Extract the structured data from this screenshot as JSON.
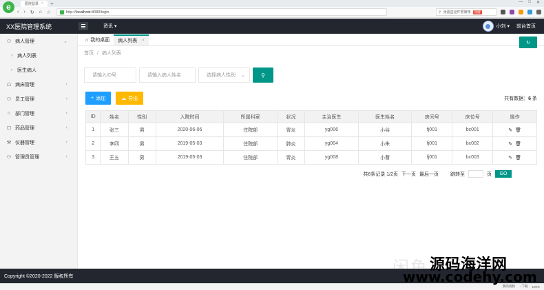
{
  "browser": {
    "tab_title": "医院登录",
    "url_scheme": "http://",
    "url_host": "localhost",
    "url_path": ":8080/login",
    "search_placeholder": "张嘉益证件照被用",
    "hot_badge": "热搜",
    "new_tab": "+",
    "win_controls": [
      "—",
      "□",
      "✕"
    ]
  },
  "header": {
    "app_name": "XX医院管理系统",
    "news": "资讯 ▾",
    "user": "小刘 ▾",
    "front_page": "前台首页"
  },
  "sidebar": {
    "items": [
      {
        "icon": "person-icon",
        "glyph": "⚇",
        "label": "病人管理",
        "arrow": "⌄"
      },
      {
        "sub": true,
        "label": "病人列表"
      },
      {
        "sub": true,
        "label": "医生病人"
      },
      {
        "icon": "bed-icon",
        "glyph": "☖",
        "label": "病床管理",
        "arrow": "‹"
      },
      {
        "icon": "staff-icon",
        "glyph": "⚇",
        "label": "员工管理",
        "arrow": "‹"
      },
      {
        "icon": "dept-icon",
        "glyph": "⌂",
        "label": "部门管理",
        "arrow": "‹"
      },
      {
        "icon": "drug-icon",
        "glyph": "☐",
        "label": "药品管理",
        "arrow": "‹"
      },
      {
        "icon": "device-icon",
        "glyph": "⚒",
        "label": "仪器管理",
        "arrow": "‹"
      },
      {
        "icon": "admin-icon",
        "glyph": "⚇",
        "label": "管理员管理",
        "arrow": "‹"
      }
    ]
  },
  "tabs": [
    {
      "label": "我的桌面",
      "glyph": "⌂",
      "active": false
    },
    {
      "label": "病人列表",
      "active": true,
      "close": "×"
    }
  ],
  "breadcrumb": [
    "首页",
    "病人列表"
  ],
  "breadcrumb_sep": "/",
  "refresh_label": "↻",
  "search": {
    "id_placeholder": "请输入ID号",
    "name_placeholder": "请输入病人姓名",
    "gender_placeholder": "选择病人性别",
    "button_glyph": "🔍"
  },
  "actions": {
    "add": "添加",
    "export": "导出",
    "total_prefix": "共有数据：",
    "total_count": "6",
    "total_suffix": " 条"
  },
  "table": {
    "columns": [
      "ID",
      "姓名",
      "性别",
      "入院时间",
      "所属科室",
      "状况",
      "主治医生",
      "医生姓名",
      "房间号",
      "床位号",
      "操作"
    ],
    "rows": [
      [
        "1",
        "张三",
        "男",
        "2020-06-06",
        "住院部",
        "胃炎",
        "yg006",
        "小谷",
        "fj001",
        "bc001"
      ],
      [
        "2",
        "李四",
        "男",
        "2019-05-03",
        "住院部",
        "肺炎",
        "yg004",
        "小朱",
        "fj001",
        "bc002"
      ],
      [
        "3",
        "王五",
        "男",
        "2019-05-03",
        "住院部",
        "胃炎",
        "yg008",
        "小曹",
        "fj001",
        "bc003"
      ]
    ]
  },
  "pager": {
    "summary": "共6条记录  1/2页",
    "next": "下一页",
    "last": "最后一页",
    "jump_label": "跳转至",
    "page_unit": "页",
    "go": "GO"
  },
  "watermark_text": "闲鱼 · 代码乐",
  "watermark_site": "源码海洋网",
  "watermark_url": "www.codehy.com",
  "footer": "Copyright ©2020-2022 版权所有",
  "status": [
    "我的视频",
    "↓ 下载",
    "100%"
  ],
  "colors": {
    "primary": "#009688",
    "blue": "#1e9fff",
    "orange": "#ffb800",
    "dark": "#23262e"
  }
}
